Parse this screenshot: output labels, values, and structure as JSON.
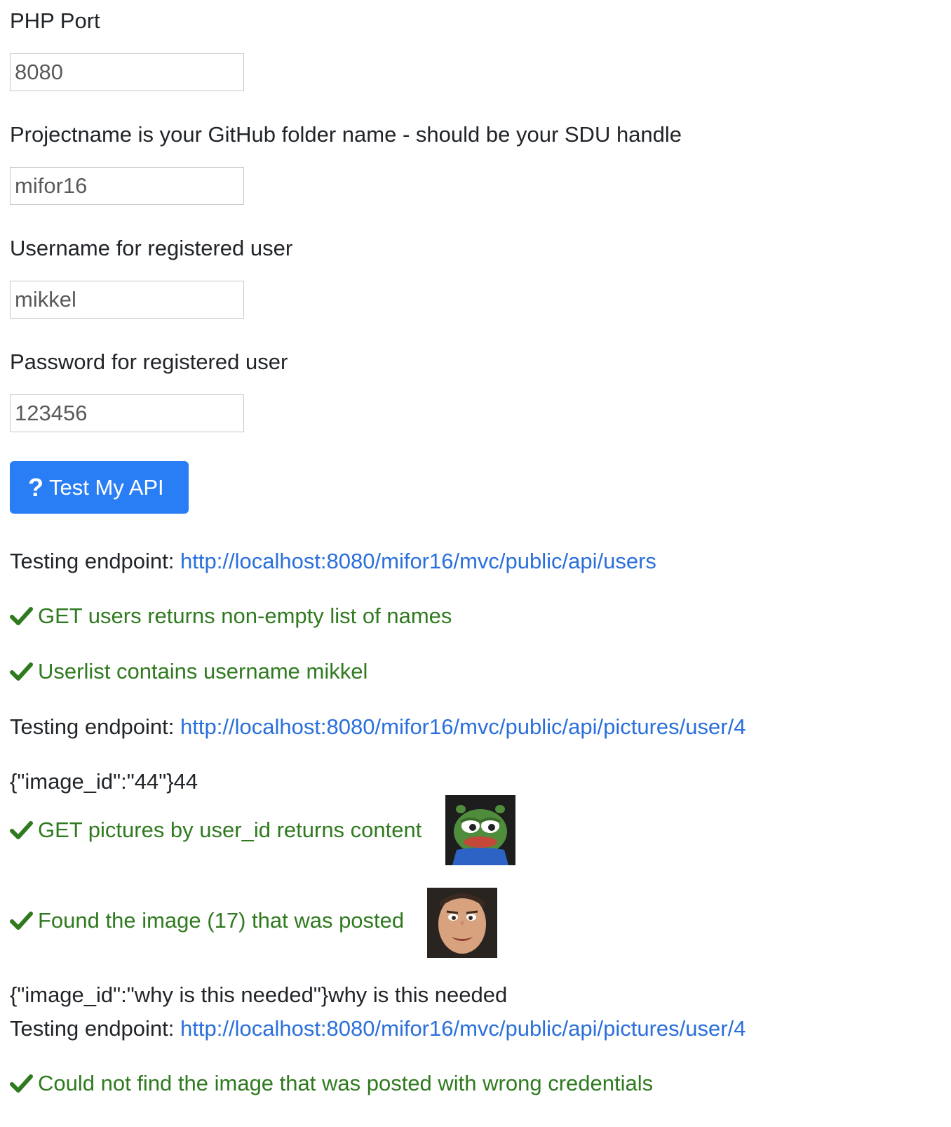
{
  "form": {
    "port_label": "PHP Port",
    "port_value": "8080",
    "project_label": "Projectname is your GitHub folder name - should be your SDU handle",
    "project_value": "mifor16",
    "username_label": "Username for registered user",
    "username_value": "mikkel",
    "password_label": "Password for registered user",
    "password_value": "123456",
    "test_button_label": "Test My API",
    "test_button_icon": "question-icon"
  },
  "results": {
    "testing_prefix": "Testing endpoint:",
    "endpoint_users": "http://localhost:8080/mifor16/mvc/public/api/users",
    "check1": "GET users returns non-empty list of names",
    "check2": "Userlist contains username mikkel",
    "endpoint_pictures": "http://localhost:8080/mifor16/mvc/public/api/pictures/user/4",
    "json_output1": "{\"image_id\":\"44\"}44",
    "check3": "GET pictures by user_id returns content",
    "check4": "Found the image (17) that was posted",
    "json_output2": "{\"image_id\":\"why is this needed\"}why is this needed",
    "endpoint_pictures_2": "http://localhost:8080/mifor16/mvc/public/api/pictures/user/4",
    "check5": "Could not find the image that was posted with wrong credentials"
  },
  "colors": {
    "button": "#2a7ef5",
    "link": "#2a6fdb",
    "success": "#2f7a1f"
  }
}
